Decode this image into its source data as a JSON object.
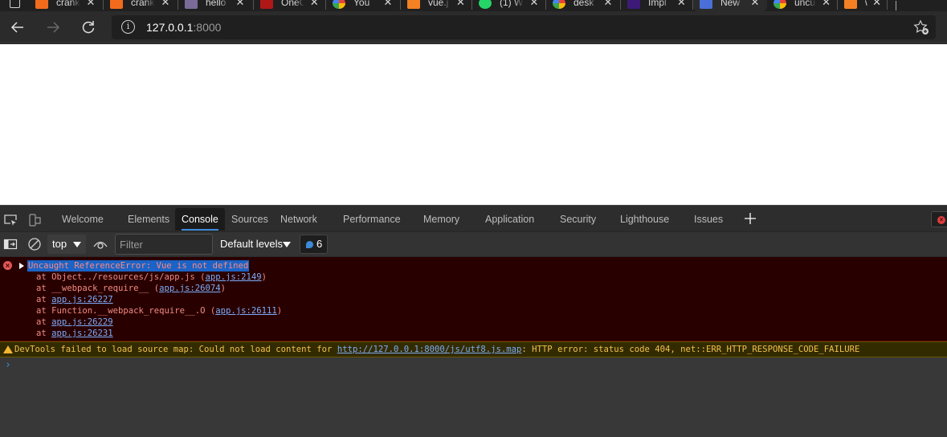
{
  "browser": {
    "tabs": [
      {
        "title": "crank",
        "favicon": "orange-logo",
        "color": "#f26b1d",
        "active": false
      },
      {
        "title": "crank",
        "favicon": "orange-logo",
        "color": "#f26b1d",
        "active": false
      },
      {
        "title": "hello",
        "favicon": "image-thumbnail",
        "color": "#7a6a9a",
        "active": false
      },
      {
        "title": "OneC",
        "favicon": "red-logo",
        "color": "#b01818",
        "active": false
      },
      {
        "title": "You",
        "favicon": "google-logo",
        "color": "#4285f4",
        "active": false
      },
      {
        "title": "vue.j",
        "favicon": "stackoverflow-logo",
        "color": "#f48024",
        "active": false
      },
      {
        "title": "(1) W",
        "favicon": "whatsapp-logo",
        "color": "#25d366",
        "active": false
      },
      {
        "title": "desk",
        "favicon": "google-logo",
        "color": "#4285f4",
        "active": false
      },
      {
        "title": "Impl",
        "favicon": "purple-logo",
        "color": "#3d1a78",
        "active": false
      },
      {
        "title": "New",
        "favicon": "grid-logo",
        "color": "#4a6fd8",
        "active": true
      },
      {
        "title": "uncu",
        "favicon": "google-logo",
        "color": "#4285f4",
        "active": false
      },
      {
        "title": "why",
        "favicon": "stackoverflow-logo",
        "color": "#f48024",
        "active": false
      }
    ],
    "address": {
      "host": "127.0.0.1",
      "port": ":8000"
    }
  },
  "devtools": {
    "tabs": [
      {
        "label": "Welcome",
        "active": false
      },
      {
        "label": "Elements",
        "active": false
      },
      {
        "label": "Console",
        "active": true
      },
      {
        "label": "Sources",
        "active": false
      },
      {
        "label": "Network",
        "active": false
      },
      {
        "label": "Performance",
        "active": false
      },
      {
        "label": "Memory",
        "active": false
      },
      {
        "label": "Application",
        "active": false
      },
      {
        "label": "Security",
        "active": false
      },
      {
        "label": "Lighthouse",
        "active": false
      },
      {
        "label": "Issues",
        "active": false
      }
    ],
    "console_toolbar": {
      "context": "top",
      "filter_placeholder": "Filter",
      "levels": "Default levels",
      "issues_count": "6"
    },
    "messages": {
      "error": {
        "headline": "Uncaught ReferenceError: Vue is not defined",
        "stack": [
          {
            "prefix": "at Object../resources/js/app.js (",
            "link": "app.js:2149",
            "suffix": ")"
          },
          {
            "prefix": "at __webpack_require__ (",
            "link": "app.js:26074",
            "suffix": ")"
          },
          {
            "prefix": "at ",
            "link": "app.js:26227",
            "suffix": ""
          },
          {
            "prefix": "at Function.__webpack_require__.O (",
            "link": "app.js:26111",
            "suffix": ")"
          },
          {
            "prefix": "at ",
            "link": "app.js:26229",
            "suffix": ""
          },
          {
            "prefix": "at ",
            "link": "app.js:26231",
            "suffix": ""
          }
        ]
      },
      "warning": {
        "prefix": "DevTools failed to load source map: Could not load content for ",
        "link": "http://127.0.0.1:8000/js/utf8.js.map",
        "suffix": ": HTTP error: status code 404, net::ERR_HTTP_RESPONSE_CODE_FAILURE"
      }
    },
    "prompt_symbol": "›"
  }
}
